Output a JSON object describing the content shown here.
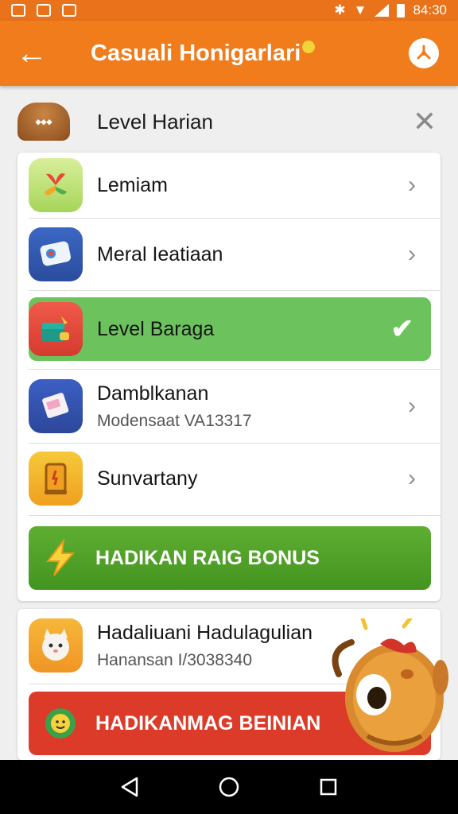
{
  "status_bar": {
    "time": "84:30"
  },
  "app_bar": {
    "title": "Casuali Honigarlari"
  },
  "header": {
    "title": "Level Harian"
  },
  "menu_items": [
    {
      "label": "Lemiam",
      "sub": ""
    },
    {
      "label": "Meral Ieatiaan",
      "sub": ""
    },
    {
      "label": "Level Baraga",
      "sub": "",
      "selected": true
    },
    {
      "label": "Damblkanan",
      "sub": "Modensaat VA13317"
    },
    {
      "label": "Sunvartany",
      "sub": ""
    }
  ],
  "bonus_green": {
    "label": "HADIKAN RAIG BONUS"
  },
  "bottom_item": {
    "label": "Hadaliuani Hadulagulian",
    "sub": "Hanansan I/3038340"
  },
  "bonus_red": {
    "label": "HADIKANMAG BEINIAN"
  },
  "colors": {
    "primary": "#f07c1c",
    "selected": "#6cc35d",
    "bonus_green": "#4e9f26",
    "bonus_red": "#dc3b2a"
  }
}
